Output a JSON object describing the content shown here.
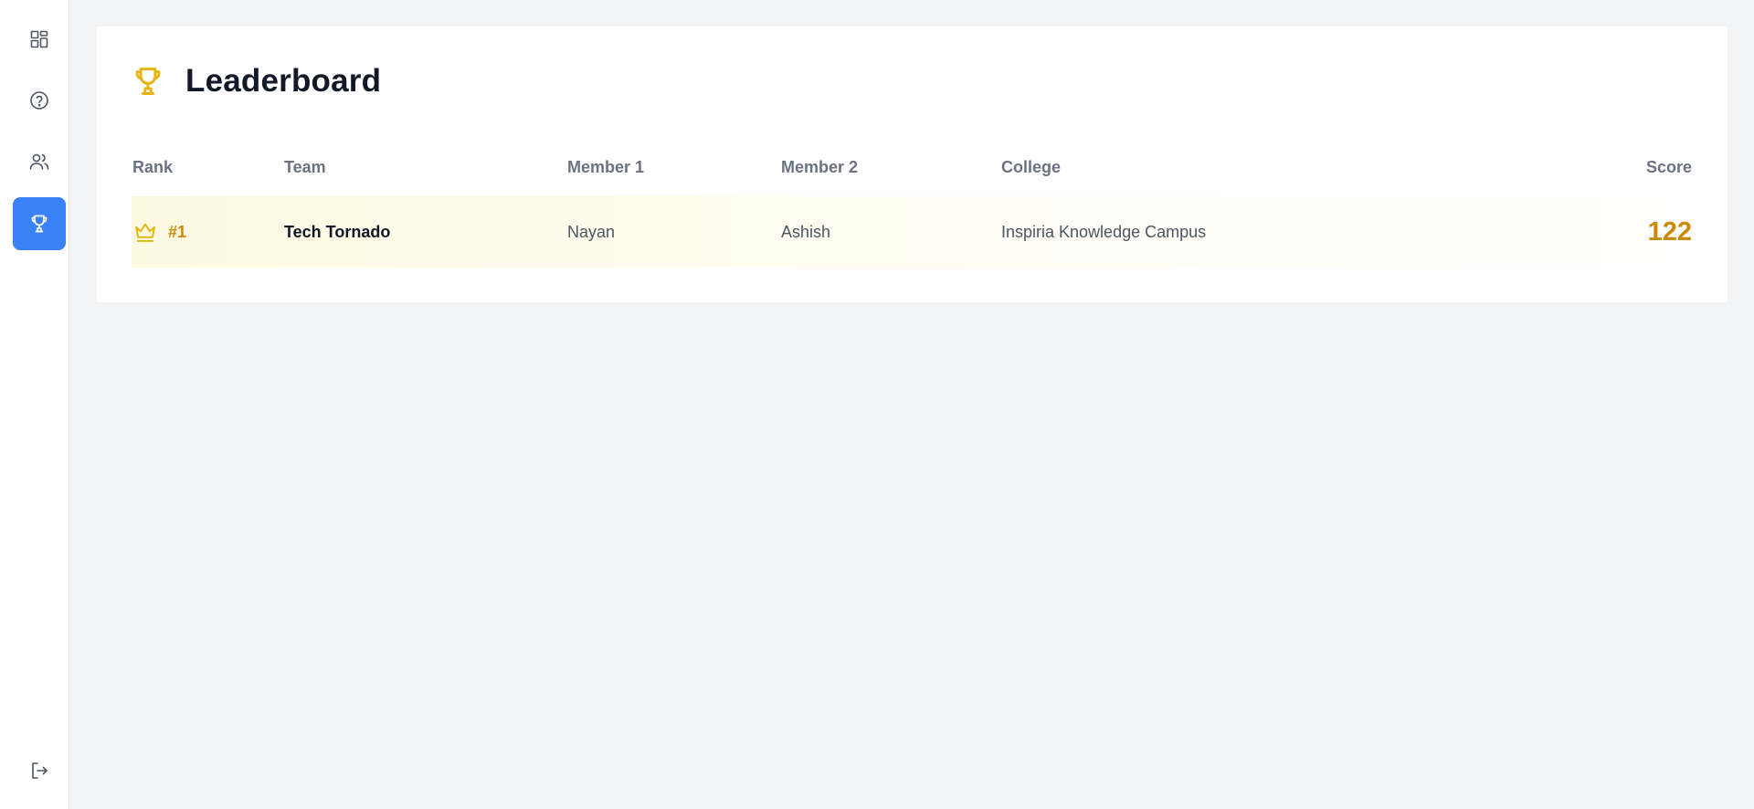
{
  "sidebar": {
    "items": [
      {
        "icon": "dashboard-icon",
        "active": false
      },
      {
        "icon": "help-circle-icon",
        "active": false
      },
      {
        "icon": "users-icon",
        "active": false
      },
      {
        "icon": "trophy-icon",
        "active": true
      }
    ],
    "logout_icon": "logout-icon"
  },
  "leaderboard": {
    "title": "Leaderboard",
    "columns": {
      "rank": "Rank",
      "team": "Team",
      "member1": "Member 1",
      "member2": "Member 2",
      "college": "College",
      "score": "Score"
    },
    "rows": [
      {
        "rank": "#1",
        "team": "Tech Tornado",
        "member1": "Nayan",
        "member2": "Ashish",
        "college": "Inspiria Knowledge Campus",
        "score": "122"
      }
    ]
  },
  "colors": {
    "accent": "#3b82f6",
    "gold": "#ca8a04",
    "trophy": "#eab308"
  }
}
